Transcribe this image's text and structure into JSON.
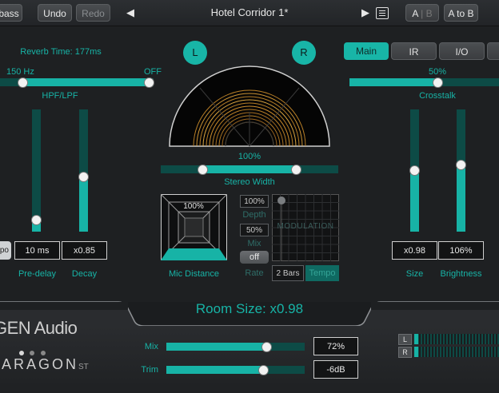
{
  "toolbar": {
    "bypass_label": "bass",
    "undo_label": "Undo",
    "redo_label": "Redo",
    "preset_name": "Hotel Corridor 1*",
    "ab_a": "A",
    "ab_sep": "|",
    "ab_b": "B",
    "a_to_b_label": "A to B"
  },
  "left": {
    "reverb_time_label": "Reverb Time: 177ms",
    "hpf_value": "150 Hz",
    "lpf_value": "OFF",
    "filter_label": "HPF/LPF",
    "predelay_sync_label": "po",
    "predelay_value": "10 ms",
    "decay_value": "x0.85",
    "predelay_label": "Pre-delay",
    "decay_label": "Decay",
    "predelay_level": 0.1,
    "decay_level": 0.45
  },
  "center": {
    "left_label": "L",
    "right_label": "R",
    "stereo_width_value": "100%",
    "stereo_width_label": "Stereo Width",
    "mic_distance_value": "100%",
    "mic_distance_label": "Mic Distance",
    "depth_value": "100%",
    "depth_label": "Depth",
    "mix_value": "50%",
    "mix_label": "Mix",
    "rate_toggle": "off",
    "rate_label": "Rate",
    "modulation_label": "MODULATION",
    "bars_value": "2 Bars",
    "tempo_label": "Tempo"
  },
  "right": {
    "tabs": [
      "Main",
      "IR",
      "I/O"
    ],
    "active_tab": "Main",
    "crosstalk_value": "50%",
    "crosstalk_label": "Crosstalk",
    "size_value": "x0.98",
    "brightness_value": "106%",
    "size_label": "Size",
    "brightness_label": "Brightness",
    "size_level": 0.5,
    "brightness_level": 0.55
  },
  "room_size_label": "Room Size: x0.98",
  "bottom": {
    "brand": "GEN Audio",
    "product": "ARAGON",
    "product_suffix": "ST",
    "mix_label": "Mix",
    "mix_value": "72%",
    "mix_level": 0.72,
    "trim_label": "Trim",
    "trim_value": "-6dB",
    "trim_level": 0.7,
    "meter_l": "L",
    "meter_r": "R"
  },
  "colors": {
    "accent": "#17b3a6",
    "track": "#0d4b46",
    "background": "#1e2022"
  }
}
